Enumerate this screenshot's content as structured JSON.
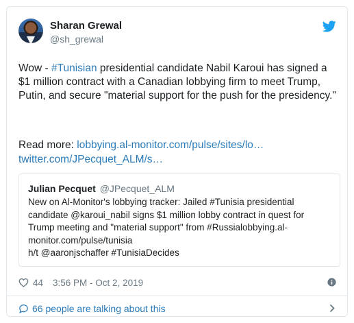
{
  "author": {
    "name": "Sharan Grewal",
    "handle": "@sh_grewal"
  },
  "tweet": {
    "text_before": "Wow - ",
    "hashtag": "#Tunisian",
    "text_after": " presidential candidate Nabil Karoui has signed a $1 million contract with a Canadian lobbying firm to meet Trump, Putin, and secure \"material support for the push for the presidency.\"",
    "read_more_label": "Read more: ",
    "link1": "lobbying.al-monitor.com/pulse/sites/lo…",
    "link2": "twitter.com/JPecquet_ALM/s…"
  },
  "quoted": {
    "name": "Julian Pecquet",
    "handle": "@JPecquet_ALM",
    "line1": "New on Al-Monitor's lobbying tracker: Jailed #Tunisia presidential",
    "line2": "candidate @karoui_nabil signs $1 million lobby contract in quest for",
    "line3": "Trump meeting and \"material support\" from #Russialobbying.al-",
    "line4": "monitor.com/pulse/tunisia",
    "line5": "h/t @aaronjschaffer #TunisiaDecides"
  },
  "meta": {
    "likes": "44",
    "timestamp": "3:56 PM - Oct 2, 2019"
  },
  "footer": {
    "talking": "66 people are talking about this"
  },
  "colors": {
    "link": "#2b7bb9",
    "twitter_blue": "#1da1f2",
    "muted": "#697882"
  },
  "icons": [
    "twitter-bird-icon",
    "heart-icon",
    "info-icon",
    "speech-bubble-icon",
    "chevron-right-icon"
  ]
}
